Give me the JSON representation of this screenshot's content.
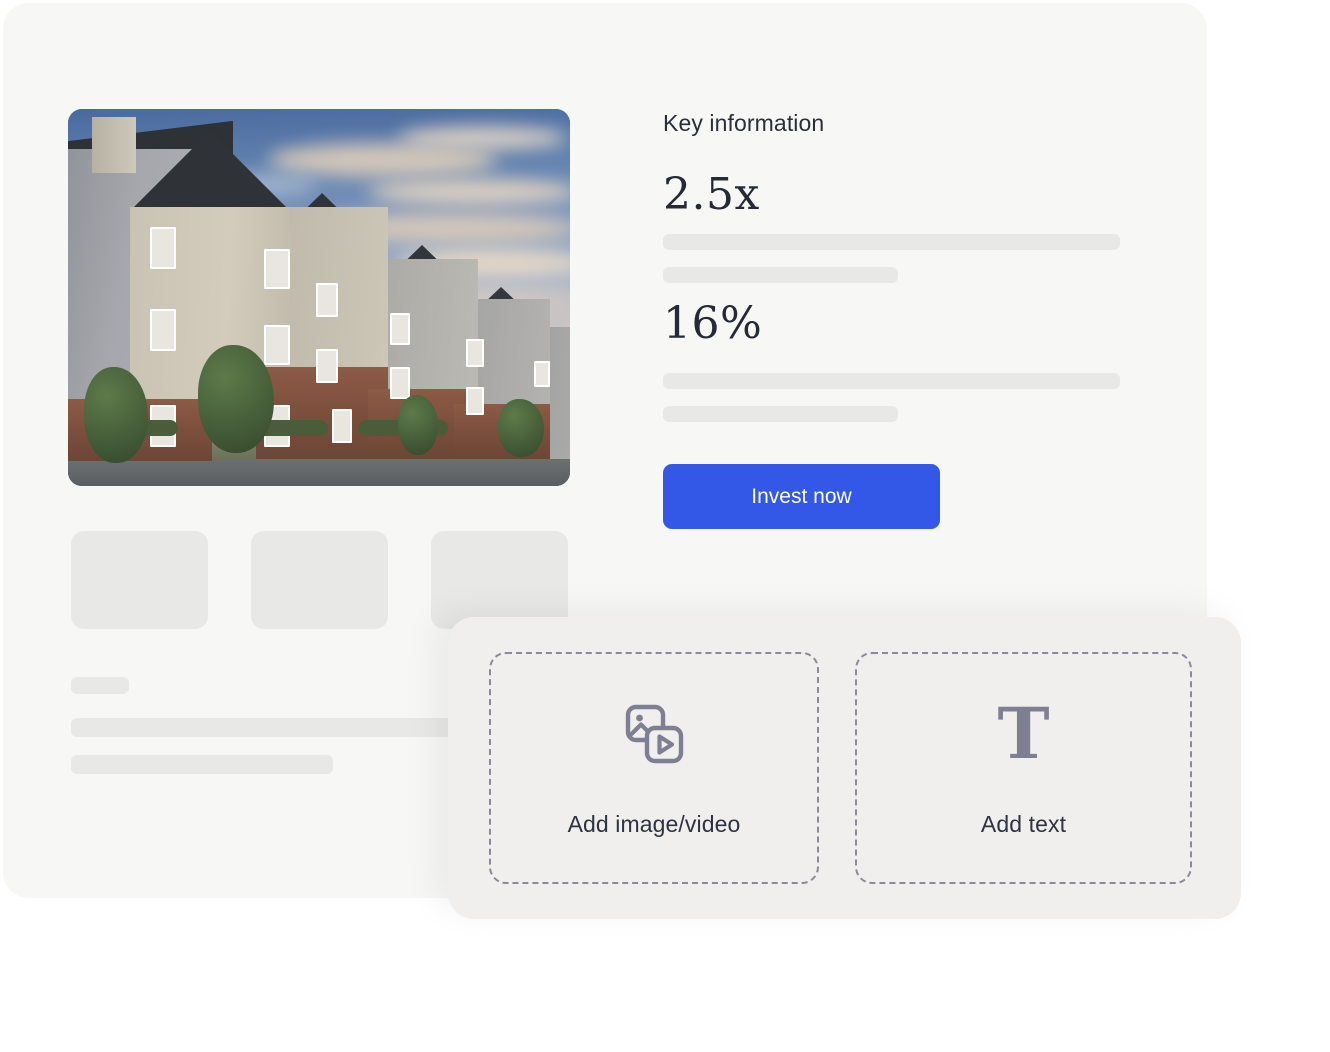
{
  "main_card": {
    "photo": {
      "alt": "apartment-building-exterior-at-sunset"
    },
    "key_info": {
      "label": "Key information",
      "stats": [
        {
          "value": "2.5x"
        },
        {
          "value": "16%"
        }
      ],
      "cta": {
        "label": "Invest now",
        "color": "#3358e8"
      }
    }
  },
  "add_block_panel": {
    "zones": [
      {
        "icon": "image-video-icon",
        "label": "Add image/video"
      },
      {
        "icon": "text-icon",
        "label": "Add text"
      }
    ],
    "border_color": "#8a8a9c",
    "background": "#f0efee"
  },
  "theme": {
    "card_background": "#f7f7f5",
    "skeleton_color": "#e8e8e6",
    "text_color": "#2c2f3a",
    "serif_value_color": "#262936"
  }
}
